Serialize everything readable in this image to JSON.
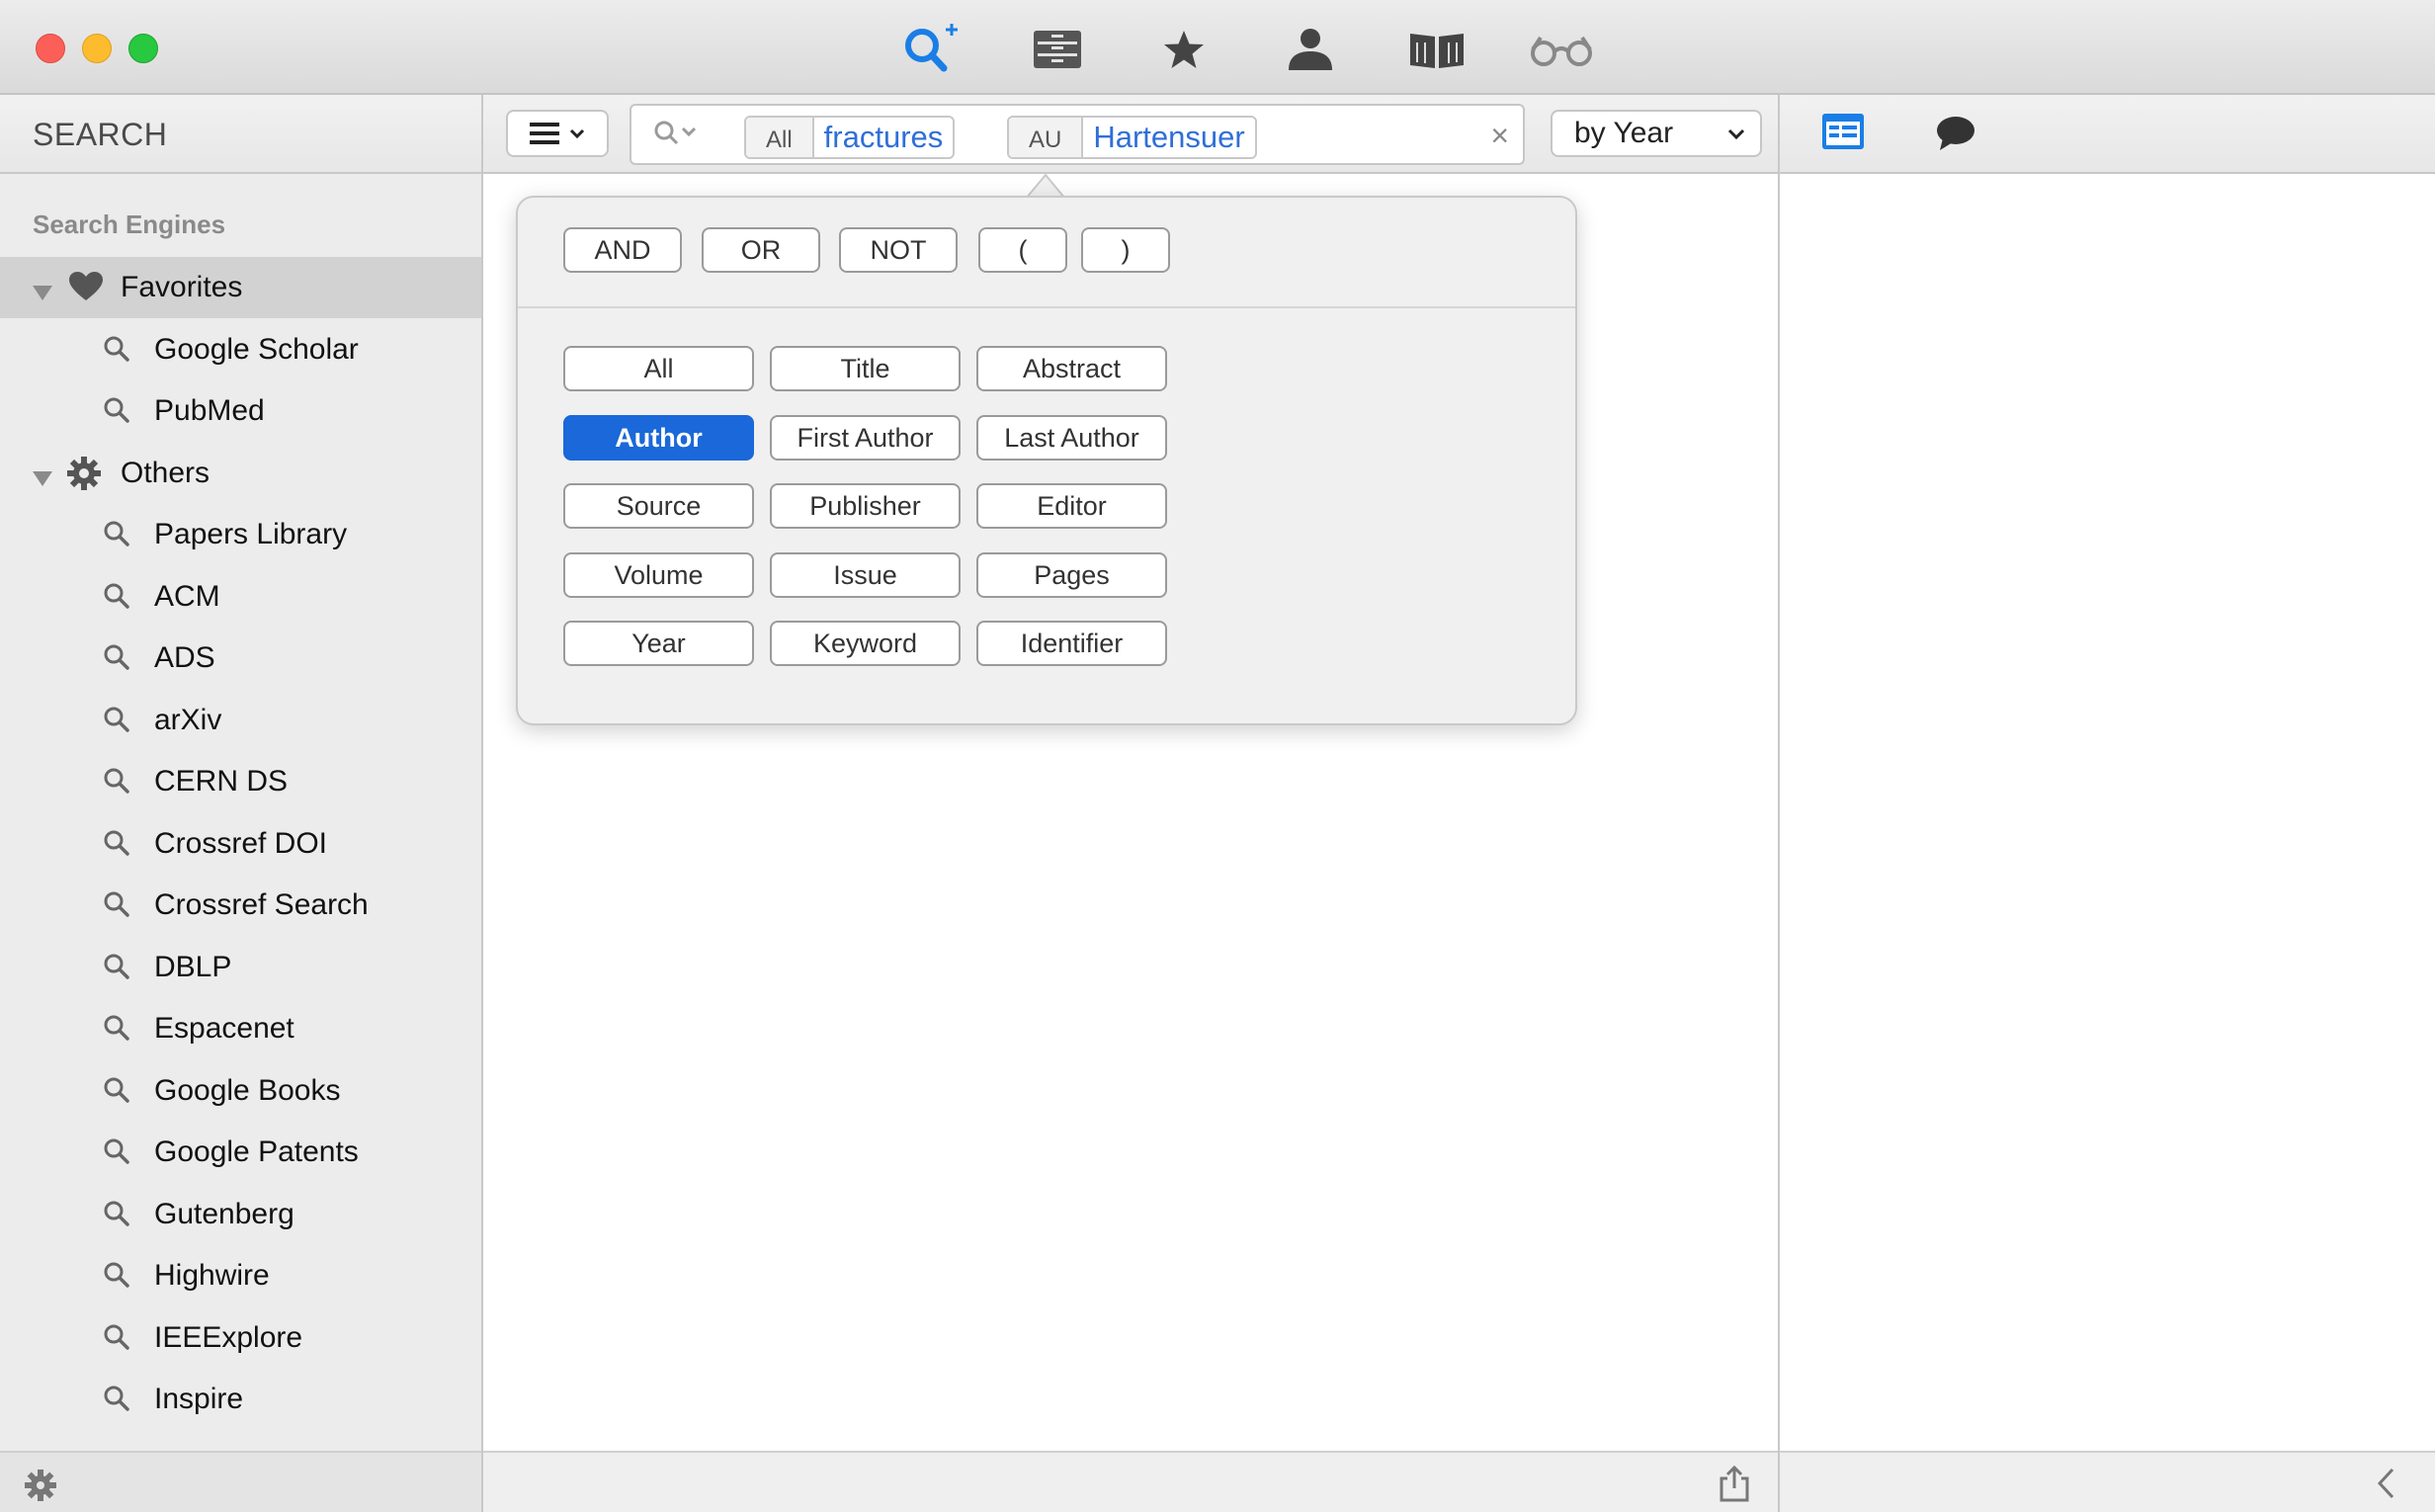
{
  "toolbar": {
    "icons": [
      "search-add-icon",
      "library-icon",
      "favorites-star-icon",
      "author-icon",
      "reader-icon",
      "glasses-icon"
    ]
  },
  "sidebar": {
    "title": "SEARCH",
    "section_header": "Search Engines",
    "groups": [
      {
        "label": "Favorites",
        "icon": "heart-icon",
        "items": [
          "Google Scholar",
          "PubMed"
        ]
      },
      {
        "label": "Others",
        "icon": "gear-icon",
        "items": [
          "Papers Library",
          "ACM",
          "ADS",
          "arXiv",
          "CERN DS",
          "Crossref DOI",
          "Crossref Search",
          "DBLP",
          "Espacenet",
          "Google Books",
          "Google Patents",
          "Gutenberg",
          "Highwire",
          "IEEExplore",
          "Inspire"
        ]
      }
    ]
  },
  "search": {
    "tokens": [
      {
        "field": "All",
        "value": "fractures"
      },
      {
        "field": "AU",
        "value": "Hartensuer"
      }
    ],
    "clear": "×"
  },
  "sort": {
    "selected": "by Year"
  },
  "popover": {
    "operators": [
      "AND",
      "OR",
      "NOT",
      "(",
      ")"
    ],
    "fields": [
      [
        "All",
        "Title",
        "Abstract"
      ],
      [
        "Author",
        "First Author",
        "Last Author"
      ],
      [
        "Source",
        "Publisher",
        "Editor"
      ],
      [
        "Volume",
        "Issue",
        "Pages"
      ],
      [
        "Year",
        "Keyword",
        "Identifier"
      ]
    ],
    "active_field": "Author"
  },
  "colors": {
    "accent": "#1a68d9",
    "token_text": "#2f6fd8",
    "close": "#fc5f57",
    "minimize": "#fdbc2e",
    "maximize": "#28c840"
  }
}
